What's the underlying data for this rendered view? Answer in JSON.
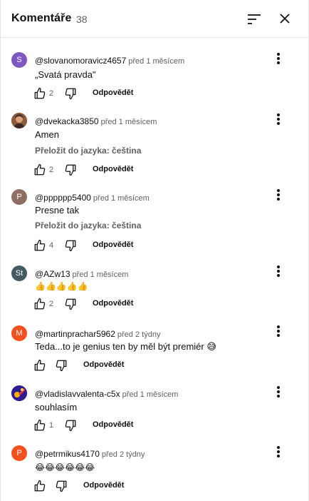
{
  "header": {
    "title": "Komentáře",
    "count": "38"
  },
  "labels": {
    "translate": "Přeložit do jazyka: čeština",
    "reply": "Odpovědět"
  },
  "comments": [
    {
      "avatar_letter": "S",
      "avatar_color": "#7e57c2",
      "author": "@slovanomoravicz4657",
      "time": "před 1 měsícem",
      "text": "„Svatá pravda\"",
      "likes": "2"
    },
    {
      "avatar_letter": "",
      "avatar_color": "#6d4c41",
      "author": "@dvekacka3850",
      "time": "před 1 měsícem",
      "text": "Amen",
      "likes": "2"
    },
    {
      "avatar_letter": "P",
      "avatar_color": "#8d6e63",
      "author": "@pppppp5400",
      "time": "před 1 měsícem",
      "text": "Presne tak",
      "likes": "4"
    },
    {
      "avatar_letter": "St",
      "avatar_color": "#455a64",
      "author": "@AZw13",
      "time": "před 1 měsícem",
      "text": "👍👍👍👍👍",
      "likes": "2"
    },
    {
      "avatar_letter": "M",
      "avatar_color": "#f4511e",
      "author": "@martinprachar5962",
      "time": "před 2 týdny",
      "text": "Teda...to je genius  ten by měl být premiér 😅",
      "likes": ""
    },
    {
      "avatar_letter": "",
      "avatar_color": "#5e35b1",
      "author": "@vladislavvalenta-c5x",
      "time": "před 1 měsícem",
      "text": "souhlasím",
      "likes": "1"
    },
    {
      "avatar_letter": "P",
      "avatar_color": "#f4511e",
      "author": "@petrmikus4170",
      "time": "před 2 týdny",
      "text": "😂😂😂😂😂😂",
      "likes": ""
    }
  ],
  "icons": {
    "sort": "sort-icon",
    "close": "close-icon",
    "like": "thumbs-up-icon",
    "dislike": "thumbs-down-icon",
    "more": "more-vertical-icon"
  }
}
